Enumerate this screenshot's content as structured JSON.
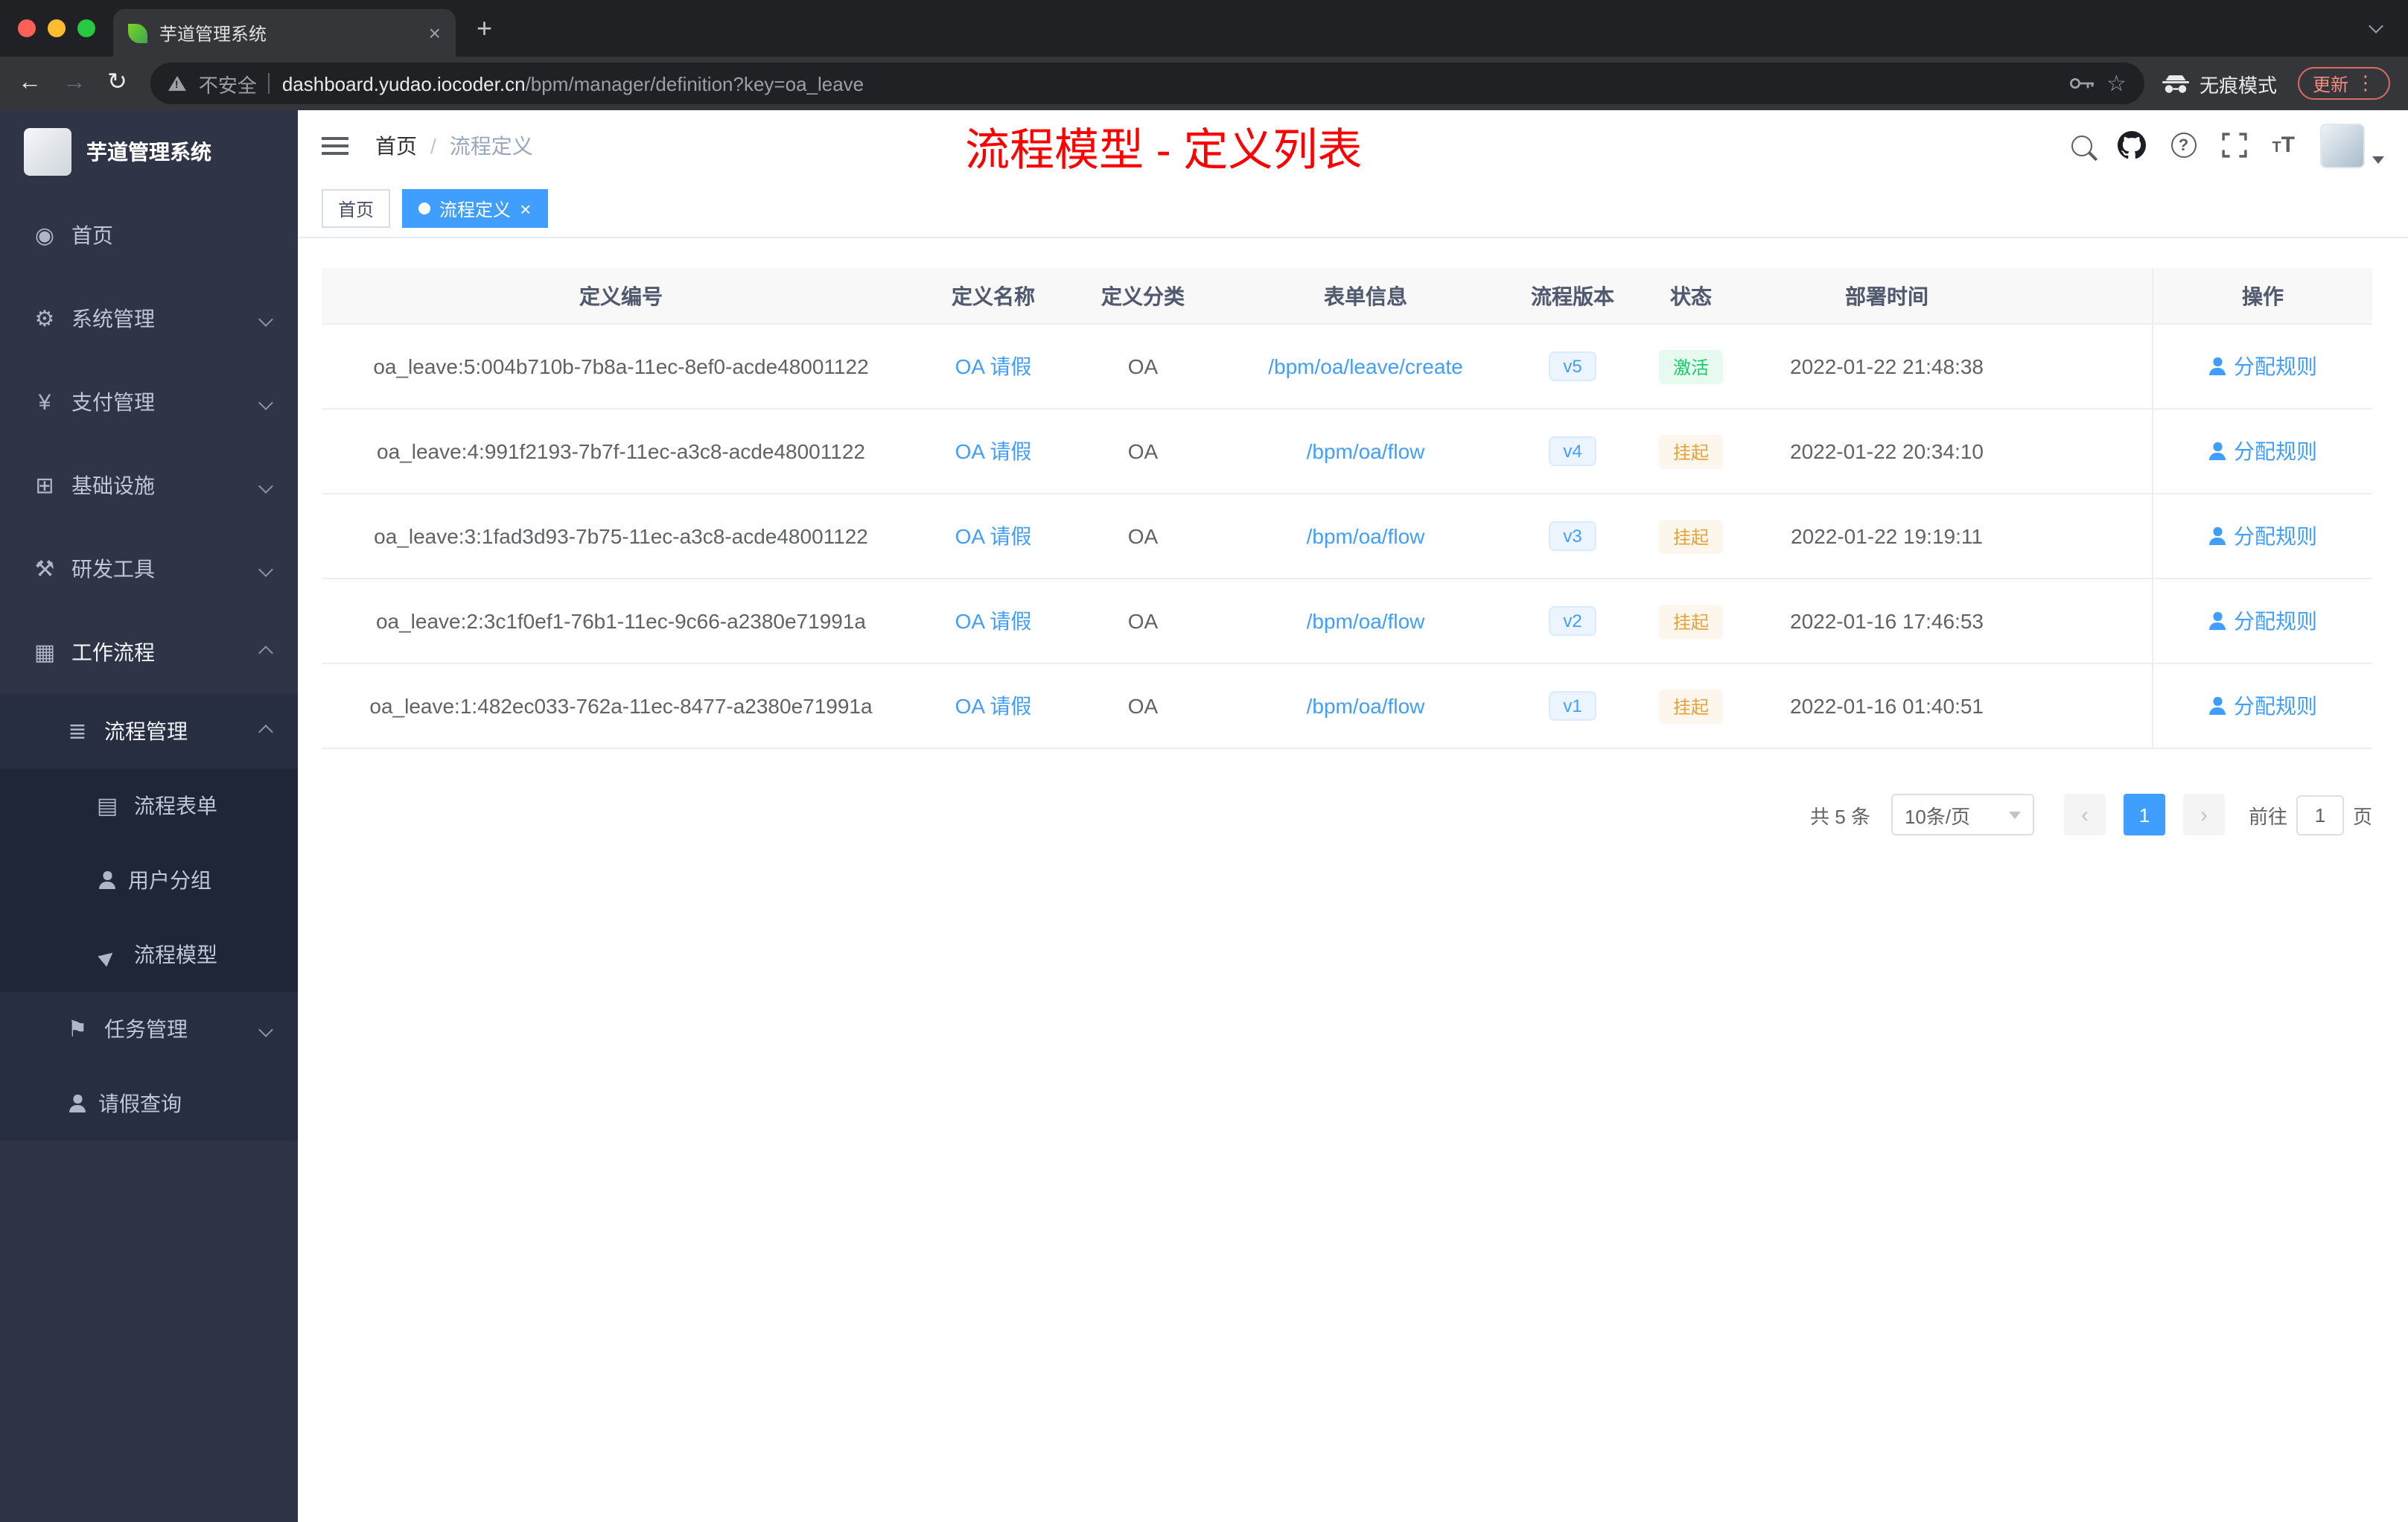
{
  "colors": {
    "accent": "#409eff",
    "annotation_red": "#ff0000",
    "status_active_text": "#13ce66",
    "status_active_bg": "#e7faf0",
    "status_suspended_text": "#e6a23c",
    "status_suspended_bg": "#fdf6ec",
    "version_badge_text": "#409eff",
    "version_badge_bg": "#ecf5ff",
    "sidebar_bg": "#2f3447",
    "update_button": "#f28b82"
  },
  "browser": {
    "tab": {
      "title": "芋道管理系统"
    },
    "toolbar": {
      "security": "不安全",
      "url_host": "dashboard.yudao.iocoder.cn",
      "url_path": "/bpm/manager/definition?key=oa_leave",
      "incognito_label": "无痕模式",
      "update_label": "更新"
    }
  },
  "icons": {
    "back": "←",
    "forward": "→",
    "reload": "↻",
    "star": "☆",
    "new_tab": "+",
    "close": "×",
    "kebab": "⋮",
    "prev": "‹",
    "next": "›",
    "home": "◉",
    "system": "⚙",
    "payment": "¥",
    "infrastructure": "⊞",
    "devtools": "⚒",
    "workflow": "▦",
    "process_management": "≣",
    "process_form": "▤",
    "process_model": "▶",
    "task_management": "⚑",
    "question": "?",
    "font_size_small": "T",
    "font_size_big": "T"
  },
  "sidebar": {
    "logo_title": "芋道管理系统",
    "items": [
      {
        "label": "首页"
      },
      {
        "label": "系统管理"
      },
      {
        "label": "支付管理"
      },
      {
        "label": "基础设施"
      },
      {
        "label": "研发工具"
      },
      {
        "label": "工作流程"
      },
      {
        "label": "流程管理"
      },
      {
        "label": "流程表单"
      },
      {
        "label": "用户分组"
      },
      {
        "label": "流程模型"
      },
      {
        "label": "任务管理"
      },
      {
        "label": "请假查询"
      }
    ]
  },
  "header": {
    "breadcrumb": [
      "首页",
      "流程定义"
    ],
    "breadcrumb_sep": "/",
    "annotation": "流程模型 - 定义列表"
  },
  "tags": [
    {
      "label": "首页"
    },
    {
      "label": "流程定义"
    }
  ],
  "table": {
    "columns": [
      "定义编号",
      "定义名称",
      "定义分类",
      "表单信息",
      "流程版本",
      "状态",
      "部署时间",
      "操作"
    ],
    "rows": [
      {
        "id": "oa_leave:5:004b710b-7b8a-11ec-8ef0-acde48001122",
        "name": "OA 请假",
        "category": "OA",
        "form": "/bpm/oa/leave/create",
        "version": "v5",
        "status": "激活",
        "time": "2022-01-22 21:48:38",
        "action": "分配规则"
      },
      {
        "id": "oa_leave:4:991f2193-7b7f-11ec-a3c8-acde48001122",
        "name": "OA 请假",
        "category": "OA",
        "form": "/bpm/oa/flow",
        "version": "v4",
        "status": "挂起",
        "time": "2022-01-22 20:34:10",
        "action": "分配规则"
      },
      {
        "id": "oa_leave:3:1fad3d93-7b75-11ec-a3c8-acde48001122",
        "name": "OA 请假",
        "category": "OA",
        "form": "/bpm/oa/flow",
        "version": "v3",
        "status": "挂起",
        "time": "2022-01-22 19:19:11",
        "action": "分配规则"
      },
      {
        "id": "oa_leave:2:3c1f0ef1-76b1-11ec-9c66-a2380e71991a",
        "name": "OA 请假",
        "category": "OA",
        "form": "/bpm/oa/flow",
        "version": "v2",
        "status": "挂起",
        "time": "2022-01-16 17:46:53",
        "action": "分配规则"
      },
      {
        "id": "oa_leave:1:482ec033-762a-11ec-8477-a2380e71991a",
        "name": "OA 请假",
        "category": "OA",
        "form": "/bpm/oa/flow",
        "version": "v1",
        "status": "挂起",
        "time": "2022-01-16 01:40:51",
        "action": "分配规则"
      }
    ]
  },
  "pagination": {
    "total": "共 5 条",
    "page_size": "10条/页",
    "page": "1",
    "goto_label": "前往",
    "goto_value": "1",
    "page_suffix": "页"
  }
}
